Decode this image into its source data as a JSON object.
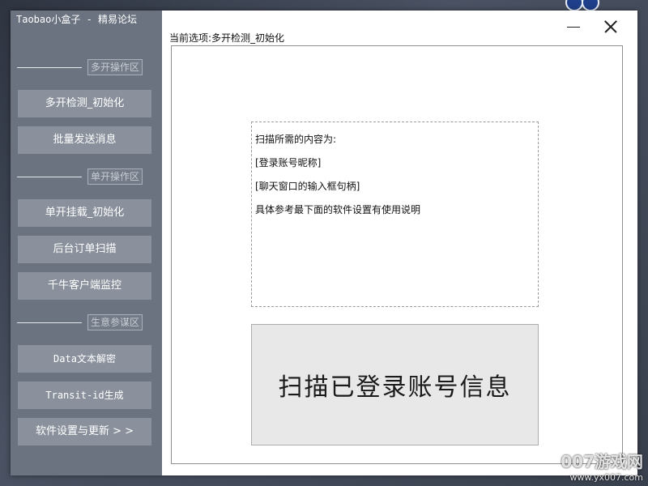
{
  "window": {
    "title": "Taobao小盒子 - 精易论坛",
    "minimize_label": "",
    "close_label": ""
  },
  "sidebar": {
    "sections": [
      {
        "label": "多开操作区"
      },
      {
        "label": "单开操作区"
      },
      {
        "label": "生意参谋区"
      }
    ],
    "buttons": [
      {
        "label": "多开检测_初始化"
      },
      {
        "label": "批量发送消息"
      },
      {
        "label": "单开挂载_初始化"
      },
      {
        "label": "后台订单扫描"
      },
      {
        "label": "千牛客户端监控"
      },
      {
        "label": "Data文本解密"
      },
      {
        "label": "Transit-id生成"
      },
      {
        "label": "软件设置与更新 > >"
      }
    ]
  },
  "main": {
    "current_tab": "当前选项:多开检测_初始化",
    "info_lines": [
      "扫描所需的内容为:",
      "[登录账号昵称]",
      "[聊天窗口的输入框句柄]",
      "具体参考最下面的软件设置有使用说明"
    ],
    "scan_button_label": "扫描已登录账号信息"
  },
  "watermark": {
    "brand": "007游戏网",
    "url": "www.yx007.com"
  },
  "icons": {
    "minimize": "minimize-icon",
    "close": "close-icon"
  },
  "colors": {
    "sidebar_bg": "#6b7380",
    "sidebar_button": "#8a919c",
    "scan_button": "#e8e8e8"
  }
}
